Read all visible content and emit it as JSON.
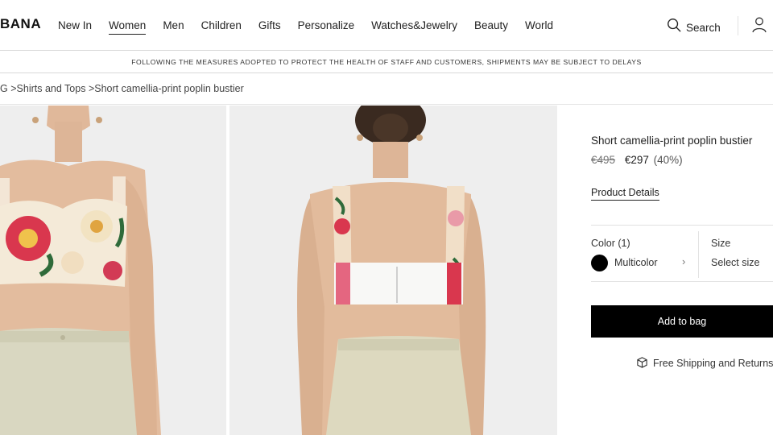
{
  "header": {
    "logo": "BANA",
    "nav": [
      "New In",
      "Women",
      "Men",
      "Children",
      "Gifts",
      "Personalize",
      "Watches&Jewelry",
      "Beauty",
      "World"
    ],
    "active_nav": "Women",
    "search_label": "Search"
  },
  "notice": "FOLLOWING THE MEASURES ADOPTED TO PROTECT THE HEALTH OF STAFF AND CUSTOMERS, SHIPMENTS MAY BE SUBJECT TO DELAYS",
  "breadcrumb": {
    "root": "G",
    "category": "Shirts and Tops",
    "current": "Short camellia-print poplin bustier",
    "separator": ">"
  },
  "product": {
    "title": "Short camellia-print poplin bustier",
    "old_price": "€495",
    "new_price": "€297",
    "discount": "(40%)",
    "details_link": "Product Details",
    "color_label": "Color (1)",
    "color_value": "Multicolor",
    "color_swatch": "#000000",
    "chevron": "›",
    "size_label": "Size",
    "size_value": "Select size",
    "add_to_bag": "Add to bag",
    "shipping_text": "Free Shipping and Returns"
  }
}
